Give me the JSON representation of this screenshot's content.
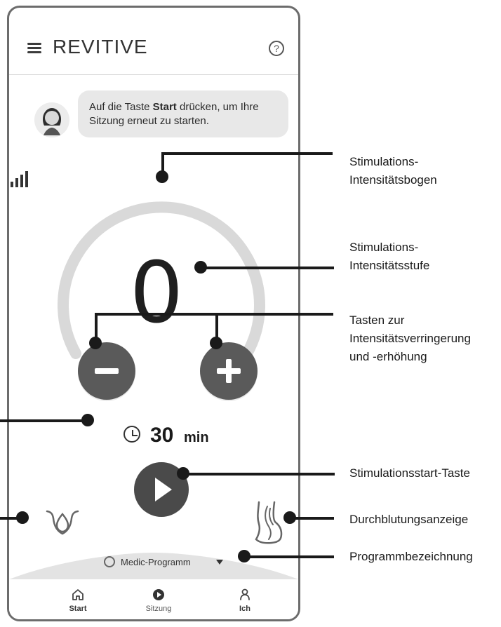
{
  "header": {
    "app_title": "REVITIVE",
    "help_glyph": "?"
  },
  "assistant": {
    "message_prefix": "Auf die Taste",
    "message_bold": "Start",
    "message_suffix": "drücken, um Ihre Sitzung erneut zu starten."
  },
  "stimulation": {
    "intensity_value": "0",
    "timer_value": "30",
    "timer_unit": "min"
  },
  "program": {
    "name": "Medic-Programm"
  },
  "bottom_nav": {
    "items": [
      {
        "label": "Start"
      },
      {
        "label": "Sitzung"
      },
      {
        "label": "Ich"
      }
    ]
  },
  "annotations": {
    "arc_label": "Stimulations-\nIntensitätsbogen",
    "level_label": "Stimulations-\nIntensitätsstufe",
    "buttons_label": "Tasten zur\nIntensitätsverringerung\nund -erhöhung",
    "start_label": "Stimulationsstart-Taste",
    "circulation_label": "Durchblutungsanzeige",
    "program_label": "Programmbezeichnung"
  },
  "icons": {
    "menu": "menu-icon",
    "help": "help-icon",
    "avatar": "avatar-icon",
    "signal": "signal-icon",
    "clock": "clock-icon",
    "play": "play-icon",
    "left_device": "water-drop-icon",
    "right_device": "leg-circulation-icon",
    "program_gear": "gear-icon",
    "caret": "chevron-down-icon",
    "home": "home-icon",
    "session": "play-circle-icon",
    "profile": "person-icon"
  }
}
